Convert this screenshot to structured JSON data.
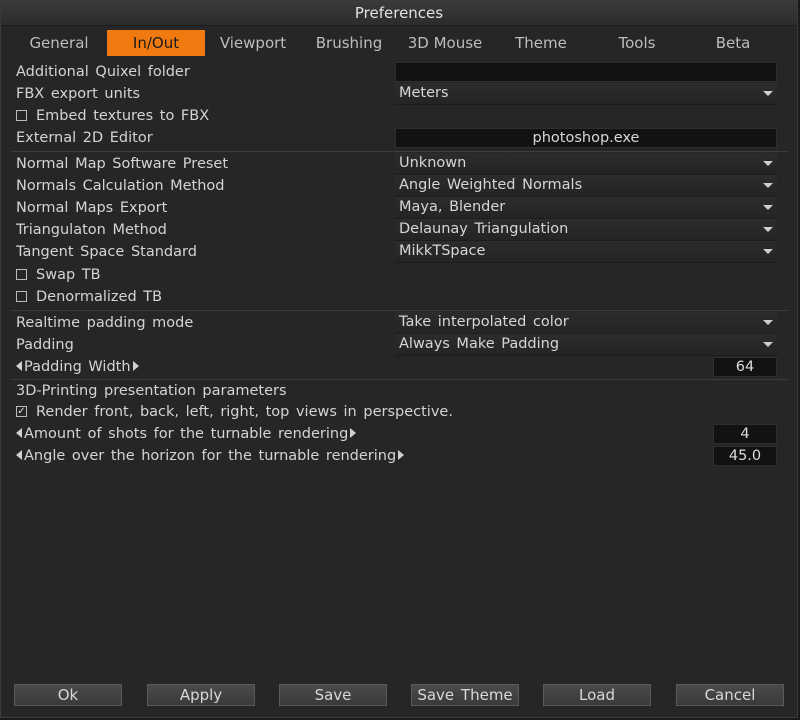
{
  "window": {
    "title": "Preferences"
  },
  "tabs": [
    {
      "label": "General",
      "active": false
    },
    {
      "label": "In/Out",
      "active": true
    },
    {
      "label": "Viewport",
      "active": false
    },
    {
      "label": "Brushing",
      "active": false
    },
    {
      "label": "3D Mouse",
      "active": false
    },
    {
      "label": "Theme",
      "active": false
    },
    {
      "label": "Tools",
      "active": false
    },
    {
      "label": "Beta",
      "active": false
    }
  ],
  "settings": {
    "quixel_folder": {
      "label": "Additional Quixel folder",
      "value": ""
    },
    "fbx_units": {
      "label": "FBX export units",
      "value": "Meters"
    },
    "embed_textures": {
      "label": "Embed textures to FBX",
      "checked": false
    },
    "external_editor": {
      "label": "External 2D Editor",
      "value": "photoshop.exe"
    },
    "normal_map_preset": {
      "label": "Normal Map Software Preset",
      "value": "Unknown"
    },
    "normals_calc": {
      "label": "Normals Calculation Method",
      "value": "Angle Weighted Normals"
    },
    "normal_maps_export": {
      "label": "Normal Maps Export",
      "value": "Maya, Blender"
    },
    "triangulation": {
      "label": "Triangulaton Method",
      "value": "Delaunay Triangulation"
    },
    "tangent_space": {
      "label": "Tangent Space Standard",
      "value": "MikkTSpace"
    },
    "swap_tb": {
      "label": "Swap TB",
      "checked": false
    },
    "denormalized_tb": {
      "label": "Denormalized TB",
      "checked": false
    },
    "padding_mode": {
      "label": "Realtime padding mode",
      "value": "Take interpolated color"
    },
    "padding": {
      "label": "Padding",
      "value": "Always Make Padding"
    },
    "padding_width": {
      "label": "Padding Width",
      "value": "64"
    },
    "printing_header": {
      "label": "3D-Printing presentation parameters"
    },
    "render_views": {
      "label": "Render front, back, left, right, top views in perspective.",
      "checked": true
    },
    "amount_shots": {
      "label": "Amount of shots for the turnable rendering",
      "value": "4"
    },
    "angle_horizon": {
      "label": "Angle over the horizon for the turnable rendering",
      "value": "45.0"
    }
  },
  "buttons": {
    "ok": "Ok",
    "apply": "Apply",
    "save": "Save",
    "save_theme": "Save Theme",
    "load": "Load",
    "cancel": "Cancel"
  },
  "colors": {
    "accent": "#f07a10",
    "background": "#262626",
    "field": "#121212"
  }
}
